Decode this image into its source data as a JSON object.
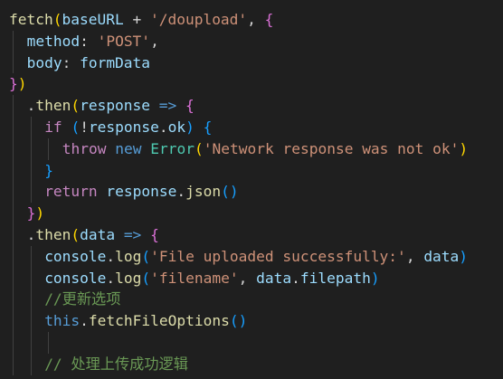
{
  "editor": {
    "language": "javascript",
    "lines": [
      [
        {
          "t": "fetch",
          "c": "fn"
        },
        {
          "t": "(",
          "c": "br1"
        },
        {
          "t": "baseURL",
          "c": "var"
        },
        {
          "t": " + ",
          "c": "op"
        },
        {
          "t": "'/doupload'",
          "c": "str"
        },
        {
          "t": ", ",
          "c": "op"
        },
        {
          "t": "{",
          "c": "br2"
        }
      ],
      [
        {
          "t": "method",
          "c": "var"
        },
        {
          "t": ": ",
          "c": "op"
        },
        {
          "t": "'POST'",
          "c": "str"
        },
        {
          "t": ",",
          "c": "op"
        }
      ],
      [
        {
          "t": "body",
          "c": "var"
        },
        {
          "t": ": ",
          "c": "op"
        },
        {
          "t": "formData",
          "c": "var"
        }
      ],
      [
        {
          "t": "}",
          "c": "br2"
        },
        {
          "t": ")",
          "c": "br1"
        }
      ],
      [
        {
          "t": ".",
          "c": "op"
        },
        {
          "t": "then",
          "c": "fn"
        },
        {
          "t": "(",
          "c": "br1"
        },
        {
          "t": "response",
          "c": "var"
        },
        {
          "t": " ",
          "c": "op"
        },
        {
          "t": "=>",
          "c": "kw"
        },
        {
          "t": " ",
          "c": "op"
        },
        {
          "t": "{",
          "c": "br2"
        }
      ],
      [
        {
          "t": "if",
          "c": "ctrl"
        },
        {
          "t": " ",
          "c": "op"
        },
        {
          "t": "(",
          "c": "br3"
        },
        {
          "t": "!",
          "c": "op"
        },
        {
          "t": "response",
          "c": "var"
        },
        {
          "t": ".",
          "c": "op"
        },
        {
          "t": "ok",
          "c": "var"
        },
        {
          "t": ")",
          "c": "br3"
        },
        {
          "t": " ",
          "c": "op"
        },
        {
          "t": "{",
          "c": "br3"
        }
      ],
      [
        {
          "t": "throw",
          "c": "ctrl"
        },
        {
          "t": " ",
          "c": "op"
        },
        {
          "t": "new",
          "c": "kw"
        },
        {
          "t": " ",
          "c": "op"
        },
        {
          "t": "Error",
          "c": "cls"
        },
        {
          "t": "(",
          "c": "br1"
        },
        {
          "t": "'Network response was not ok'",
          "c": "str"
        },
        {
          "t": ")",
          "c": "br1"
        }
      ],
      [
        {
          "t": "}",
          "c": "br3"
        }
      ],
      [
        {
          "t": "return",
          "c": "ctrl"
        },
        {
          "t": " ",
          "c": "op"
        },
        {
          "t": "response",
          "c": "var"
        },
        {
          "t": ".",
          "c": "op"
        },
        {
          "t": "json",
          "c": "fn"
        },
        {
          "t": "()",
          "c": "br3"
        }
      ],
      [
        {
          "t": "}",
          "c": "br2"
        },
        {
          "t": ")",
          "c": "br1"
        }
      ],
      [
        {
          "t": ".",
          "c": "op"
        },
        {
          "t": "then",
          "c": "fn"
        },
        {
          "t": "(",
          "c": "br1"
        },
        {
          "t": "data",
          "c": "var"
        },
        {
          "t": " ",
          "c": "op"
        },
        {
          "t": "=>",
          "c": "kw"
        },
        {
          "t": " ",
          "c": "op"
        },
        {
          "t": "{",
          "c": "br2"
        }
      ],
      [
        {
          "t": "console",
          "c": "var"
        },
        {
          "t": ".",
          "c": "op"
        },
        {
          "t": "log",
          "c": "fn"
        },
        {
          "t": "(",
          "c": "br3"
        },
        {
          "t": "'File uploaded successfully:'",
          "c": "str"
        },
        {
          "t": ", ",
          "c": "op"
        },
        {
          "t": "data",
          "c": "var"
        },
        {
          "t": ")",
          "c": "br3"
        }
      ],
      [
        {
          "t": "console",
          "c": "var"
        },
        {
          "t": ".",
          "c": "op"
        },
        {
          "t": "log",
          "c": "fn"
        },
        {
          "t": "(",
          "c": "br3"
        },
        {
          "t": "'filename'",
          "c": "str"
        },
        {
          "t": ", ",
          "c": "op"
        },
        {
          "t": "data",
          "c": "var"
        },
        {
          "t": ".",
          "c": "op"
        },
        {
          "t": "filepath",
          "c": "var"
        },
        {
          "t": ")",
          "c": "br3"
        }
      ],
      [
        {
          "t": "//更新选项",
          "c": "cmt"
        }
      ],
      [
        {
          "t": "this",
          "c": "kw"
        },
        {
          "t": ".",
          "c": "op"
        },
        {
          "t": "fetchFileOptions",
          "c": "fn"
        },
        {
          "t": "()",
          "c": "br3"
        }
      ],
      [],
      [
        {
          "t": "// 处理上传成功逻辑",
          "c": "cmt"
        }
      ]
    ],
    "indent_levels": [
      0,
      1,
      1,
      0,
      1,
      2,
      3,
      2,
      2,
      1,
      1,
      2,
      2,
      2,
      2,
      0,
      2
    ]
  },
  "colors": {
    "background": "#1f1f1f",
    "function": "#dcdcaa",
    "variable": "#9cdcfe",
    "string": "#ce9178",
    "keyword": "#569cd6",
    "control": "#c586c0",
    "class": "#4ec9b0",
    "comment": "#6a9955",
    "bracket_level1": "#ffd700",
    "bracket_level2": "#da70d6",
    "bracket_level3": "#179fff"
  }
}
